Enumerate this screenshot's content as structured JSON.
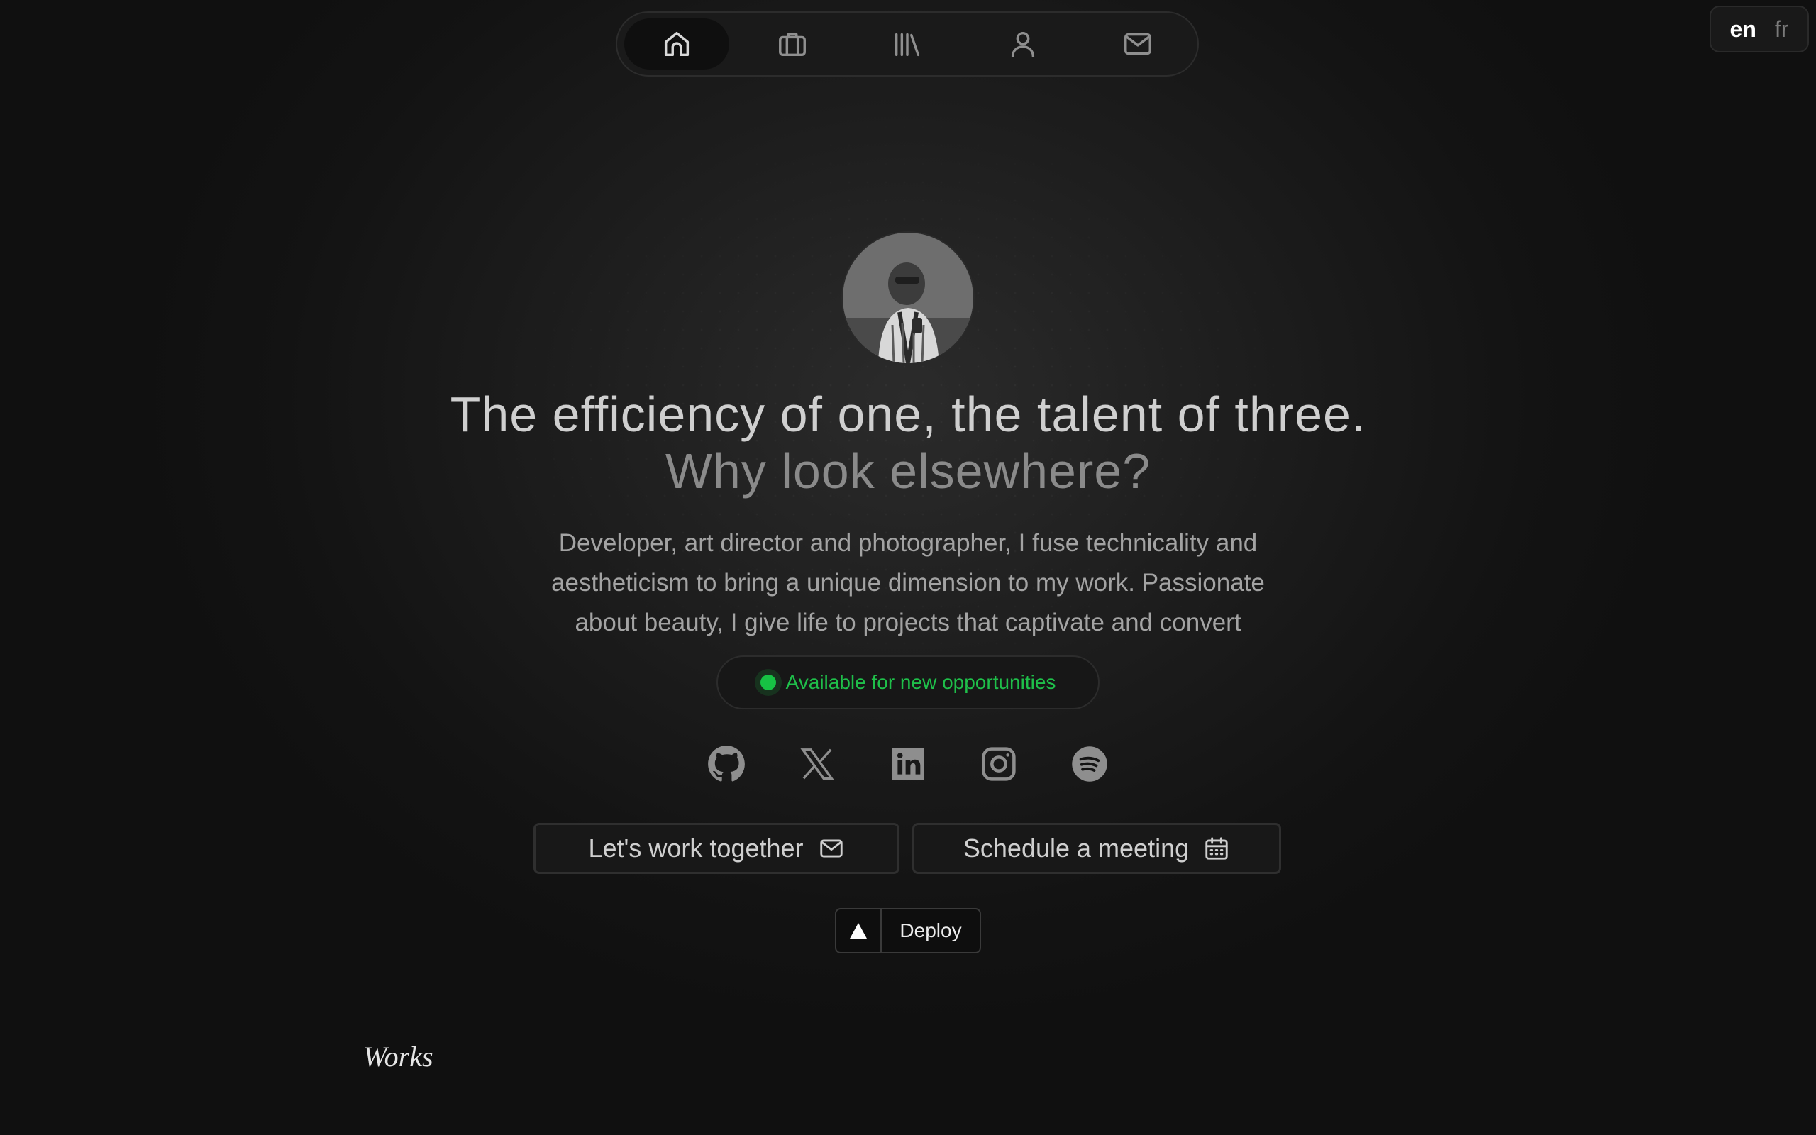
{
  "nav": {
    "items": [
      {
        "icon": "home-icon",
        "active": true
      },
      {
        "icon": "briefcase-icon",
        "active": false
      },
      {
        "icon": "library-icon",
        "active": false
      },
      {
        "icon": "user-icon",
        "active": false
      },
      {
        "icon": "mail-icon",
        "active": false
      }
    ]
  },
  "language": {
    "current": "en",
    "other": "fr"
  },
  "hero": {
    "title_line1": "The efficiency of one, the talent of three.",
    "title_line2": "Why look elsewhere?",
    "description": "Developer, art director and photographer, I fuse technicality and aestheticism to bring a unique dimension to my work. Passionate about beauty, I give life to projects that captivate and convert",
    "availability": "Available for new opportunities"
  },
  "socials": [
    "github-icon",
    "x-twitter-icon",
    "linkedin-icon",
    "instagram-icon",
    "spotify-icon"
  ],
  "buttons": {
    "work": "Let's work together",
    "meeting": "Schedule a meeting"
  },
  "deploy": {
    "label": "Deploy"
  },
  "section": {
    "works": "Works"
  },
  "colors": {
    "background": "#121212",
    "available_green": "#1fbf4a"
  }
}
